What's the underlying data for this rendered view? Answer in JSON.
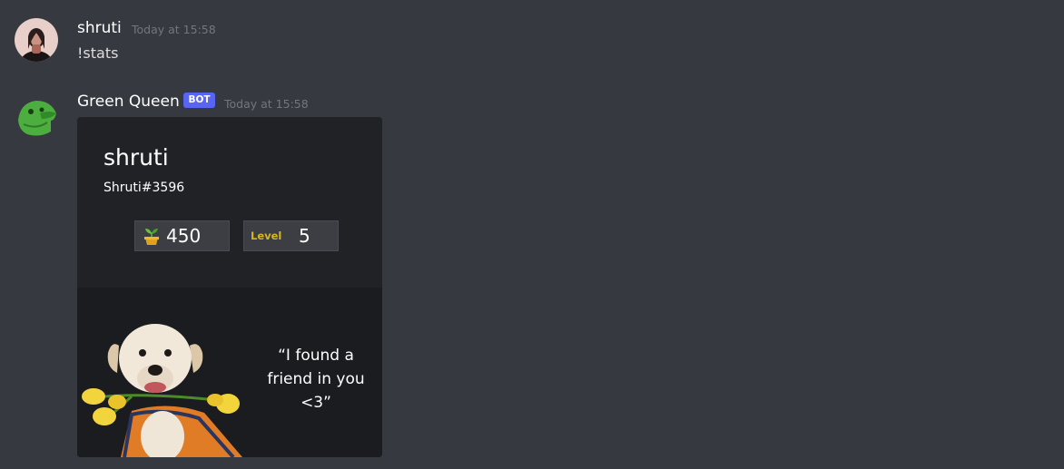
{
  "messages": [
    {
      "author": "shruti",
      "timestamp": "Today at 15:58",
      "text": "!stats"
    },
    {
      "author": "Green Queen",
      "badge": "BOT",
      "timestamp": "Today at 15:58",
      "embed": {
        "name": "shruti",
        "tag": "Shruti#3596",
        "points_icon": "sprout-icon",
        "points": "450",
        "level_label": "Level",
        "level": "5",
        "quote_lines": [
          "“I found a",
          "friend in you",
          "<3”"
        ]
      }
    }
  ],
  "colors": {
    "background": "#36393f",
    "card": "#212226",
    "bot_badge": "#5865f2",
    "level_accent": "#d4b624"
  }
}
